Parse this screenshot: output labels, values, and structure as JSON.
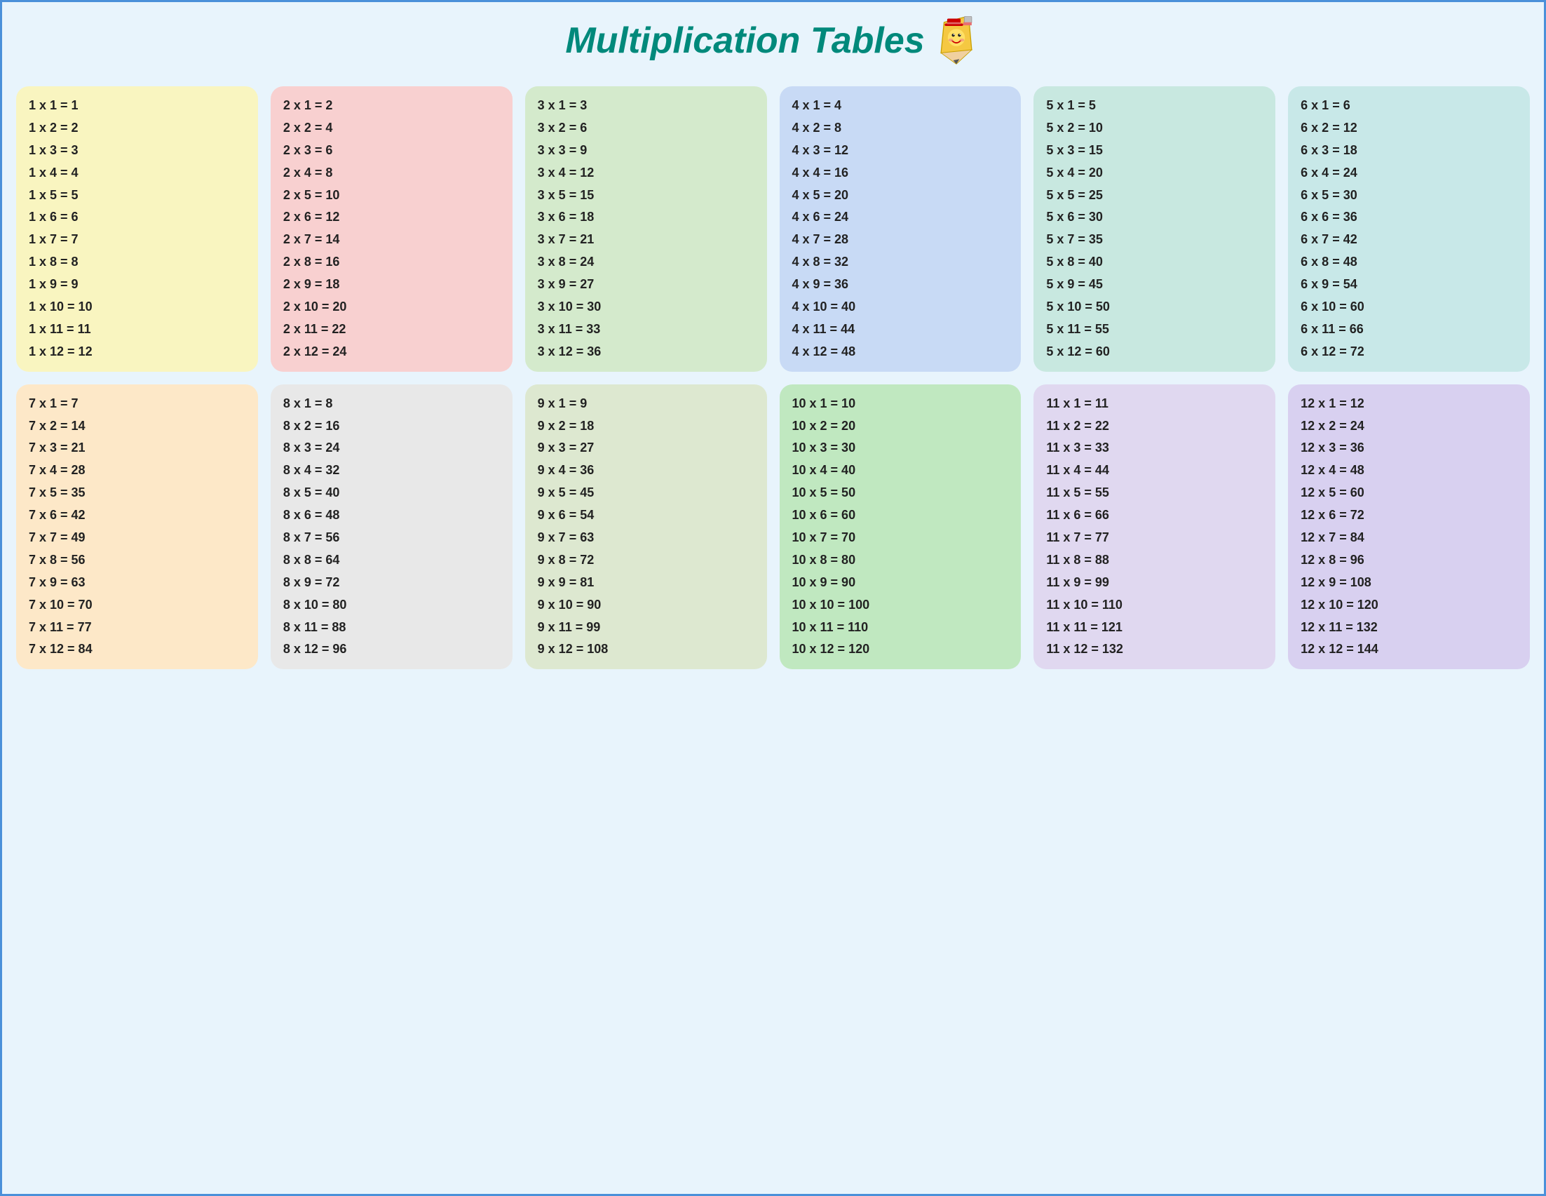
{
  "title": "Multiplication Tables",
  "tables": [
    {
      "id": 1,
      "colorClass": "card-yellow",
      "rows": [
        "1 x 1 = 1",
        "1 x 2 = 2",
        "1 x 3 = 3",
        "1 x 4 = 4",
        "1 x 5 = 5",
        "1 x 6 = 6",
        "1 x 7 = 7",
        "1 x 8 = 8",
        "1 x 9 = 9",
        "1 x 10 = 10",
        "1 x 11 = 11",
        "1 x 12 = 12"
      ]
    },
    {
      "id": 2,
      "colorClass": "card-pink",
      "rows": [
        "2 x 1 = 2",
        "2 x 2 = 4",
        "2 x 3 = 6",
        "2 x 4 = 8",
        "2 x 5 = 10",
        "2 x 6 = 12",
        "2 x 7 = 14",
        "2 x 8 = 16",
        "2 x 9 = 18",
        "2 x 10 = 20",
        "2 x 11 = 22",
        "2 x 12 = 24"
      ]
    },
    {
      "id": 3,
      "colorClass": "card-green",
      "rows": [
        "3 x 1 = 3",
        "3 x 2 = 6",
        "3 x 3 = 9",
        "3 x 4 = 12",
        "3 x 5 = 15",
        "3 x 6 = 18",
        "3 x 7 = 21",
        "3 x 8 = 24",
        "3 x 9 = 27",
        "3 x 10 = 30",
        "3 x 11 = 33",
        "3 x 12 = 36"
      ]
    },
    {
      "id": 4,
      "colorClass": "card-blue",
      "rows": [
        "4 x 1 = 4",
        "4 x 2 = 8",
        "4 x 3 = 12",
        "4 x 4 = 16",
        "4 x 5 = 20",
        "4 x 6 = 24",
        "4 x 7 = 28",
        "4 x 8 = 32",
        "4 x 9 = 36",
        "4 x 10 = 40",
        "4 x 11 = 44",
        "4 x 12 = 48"
      ]
    },
    {
      "id": 5,
      "colorClass": "card-mint",
      "rows": [
        "5 x 1 = 5",
        "5 x 2 = 10",
        "5 x 3 = 15",
        "5 x 4 = 20",
        "5 x 5 = 25",
        "5 x 6 = 30",
        "5 x 7 = 35",
        "5 x 8 = 40",
        "5 x 9 = 45",
        "5 x 10 = 50",
        "5 x 11 = 55",
        "5 x 12 = 60"
      ]
    },
    {
      "id": 6,
      "colorClass": "card-teal",
      "rows": [
        "6 x 1 = 6",
        "6 x 2 = 12",
        "6 x 3 = 18",
        "6 x 4 = 24",
        "6 x 5 = 30",
        "6 x 6 = 36",
        "6 x 7 = 42",
        "6 x 8 = 48",
        "6 x 9 = 54",
        "6 x 10 = 60",
        "6 x 11 = 66",
        "6 x 12 = 72"
      ]
    },
    {
      "id": 7,
      "colorClass": "card-orange",
      "rows": [
        "7 x 1 = 7",
        "7 x 2 = 14",
        "7 x 3 = 21",
        "7 x 4 = 28",
        "7 x 5 = 35",
        "7 x 6 = 42",
        "7 x 7 = 49",
        "7 x 8 = 56",
        "7 x 9 = 63",
        "7 x 10 = 70",
        "7 x 11 = 77",
        "7 x 12 = 84"
      ]
    },
    {
      "id": 8,
      "colorClass": "card-gray",
      "rows": [
        "8 x 1 = 8",
        "8 x 2 = 16",
        "8 x 3 = 24",
        "8 x 4 = 32",
        "8 x 5 = 40",
        "8 x 6 = 48",
        "8 x 7 = 56",
        "8 x 8 = 64",
        "8 x 9 =  72",
        "8 x 10 = 80",
        "8 x 11 = 88",
        "8 x 12 = 96"
      ]
    },
    {
      "id": 9,
      "colorClass": "card-sage",
      "rows": [
        "9 x 1 = 9",
        "9 x 2 = 18",
        "9 x 3 = 27",
        "9 x 4 = 36",
        "9 x 5 = 45",
        "9 x 6 = 54",
        "9 x 7 = 63",
        "9 x 8 = 72",
        "9 x 9 = 81",
        "9 x 10 = 90",
        "9 x 11 = 99",
        "9 x 12 = 108"
      ]
    },
    {
      "id": 10,
      "colorClass": "card-lgreen",
      "rows": [
        "10 x 1 = 10",
        "10 x 2 = 20",
        "10 x 3 = 30",
        "10 x 4 = 40",
        "10 x 5 = 50",
        "10 x 6 = 60",
        "10 x 7 = 70",
        "10 x 8 = 80",
        "10 x 9 = 90",
        "10 x 10 = 100",
        "10 x 11 = 110",
        "10 x 12 = 120"
      ]
    },
    {
      "id": 11,
      "colorClass": "card-lavend",
      "rows": [
        "11 x 1 = 11",
        "11 x 2 = 22",
        "11 x 3 = 33",
        "11 x 4 = 44",
        "11 x 5 = 55",
        "11 x 6 = 66",
        "11 x 7 = 77",
        "11 x 8 = 88",
        "11 x 9 = 99",
        "11 x 10 = 110",
        "11 x 11 = 121",
        "11 x 12 = 132"
      ]
    },
    {
      "id": 12,
      "colorClass": "card-purple",
      "rows": [
        "12 x 1 = 12",
        "12 x 2 = 24",
        "12 x 3 = 36",
        "12 x 4 = 48",
        "12 x 5 = 60",
        "12 x 6 = 72",
        "12 x 7 = 84",
        "12 x 8 = 96",
        "12 x 9 = 108",
        "12 x 10 = 120",
        "12 x 11 = 132",
        "12 x 12 = 144"
      ]
    }
  ]
}
